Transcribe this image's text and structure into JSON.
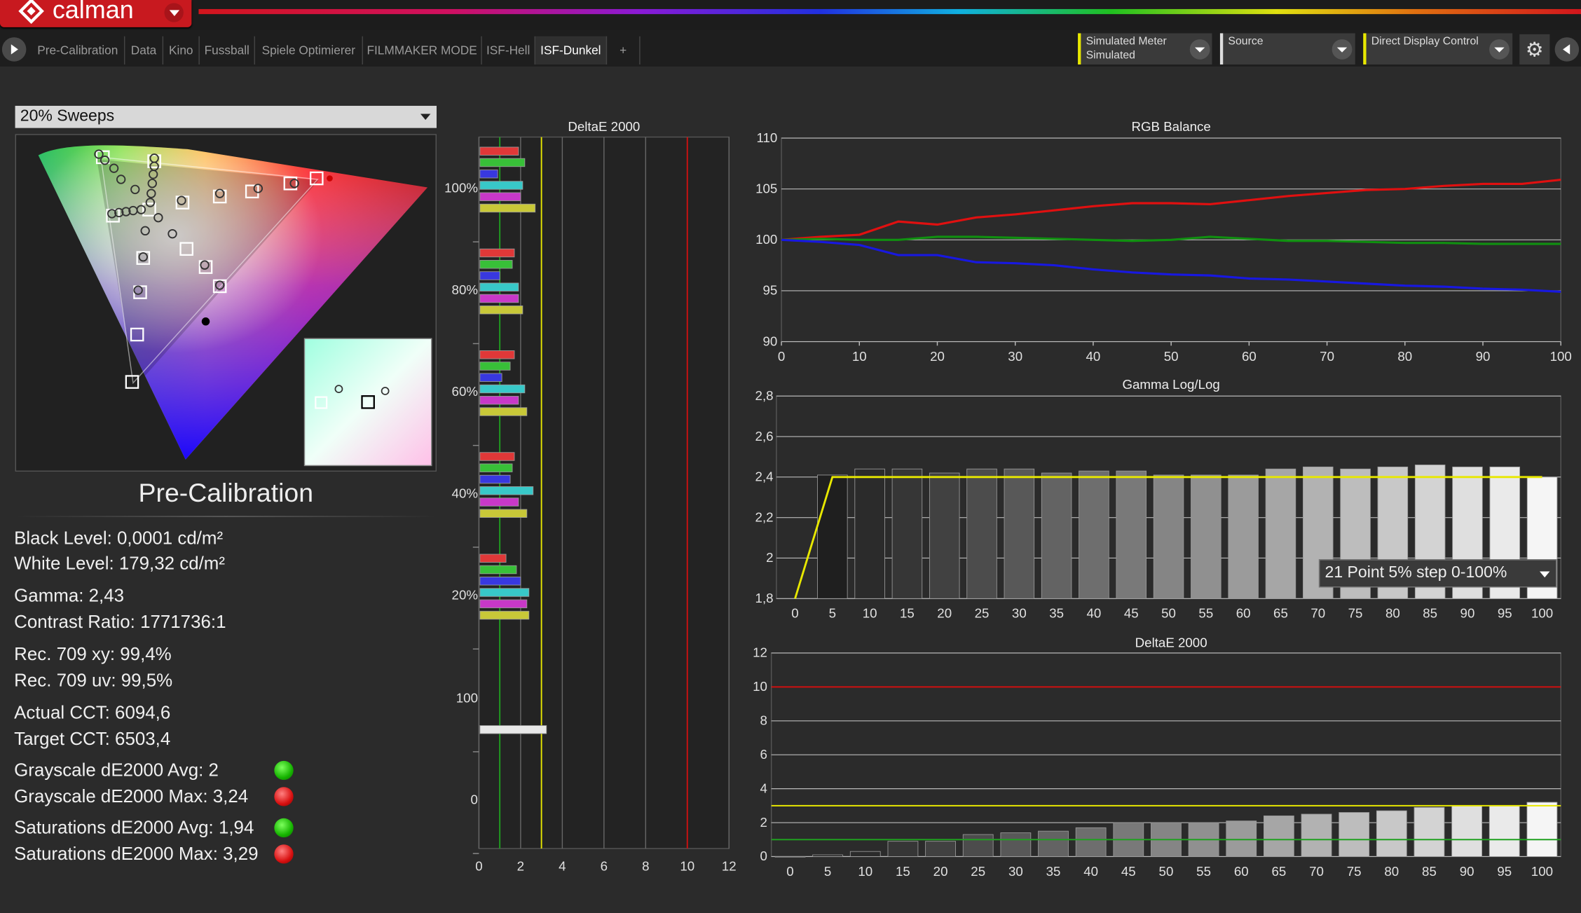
{
  "app": {
    "name": "calman"
  },
  "tabs": [
    "Pre-Calibration",
    "Data",
    "Kino",
    "Fussball",
    "Spiele Optimierer",
    "FILMMAKER MODE",
    "ISF-Hell",
    "ISF-Dunkel",
    "+"
  ],
  "active_tab": "ISF-Dunkel",
  "devices": {
    "meter": {
      "line1": "Simulated Meter",
      "line2": "Simulated"
    },
    "source": {
      "line1": "Source"
    },
    "display": {
      "line1": "Direct Display Control"
    }
  },
  "sweep_select": {
    "value": "20% Sweeps"
  },
  "gamma_select": {
    "value": "21 Point 5% step 0-100%"
  },
  "mode_title": "Pre-Calibration",
  "stats": {
    "black": "Black Level: 0,0001 cd/m²",
    "white": "White Level: 179,32 cd/m²",
    "gamma": "Gamma: 2,43",
    "contrast": "Contrast Ratio: 1771736:1",
    "xy": "Rec. 709 xy: 99,4%",
    "uv": "Rec. 709 uv: 99,5%",
    "actual_cct": "Actual CCT: 6094,6",
    "target_cct": "Target CCT: 6503,4",
    "gs_avg": "Grayscale dE2000 Avg: 2",
    "gs_max": "Grayscale dE2000 Max: 3,24",
    "sat_avg": "Saturations dE2000 Avg: 1,94",
    "sat_max": "Saturations dE2000 Max: 3,29"
  },
  "status_colors": {
    "pass": "#16b300",
    "fail": "#d81010"
  },
  "icons": [
    "play-icon",
    "add-tab-icon",
    "gear-icon",
    "collapse-left-icon",
    "dropdown-chevron-icon"
  ],
  "chart_data": [
    {
      "type": "bar",
      "title": "DeltaE 2000",
      "orientation": "horizontal",
      "xlim": [
        0,
        12
      ],
      "x_ticks": [
        "0",
        "2",
        "4",
        "6",
        "8",
        "10",
        "12"
      ],
      "group_labels": [
        "100%",
        "80%",
        "60%",
        "40%",
        "20%",
        "100",
        "0"
      ],
      "thresholds": [
        {
          "value": 1,
          "color": "#20a020"
        },
        {
          "value": 3,
          "color": "#e8e800"
        },
        {
          "value": 10,
          "color": "#d01010"
        }
      ],
      "groups": [
        {
          "label": "100%",
          "bars": [
            {
              "c": "red",
              "v": 1.9
            },
            {
              "c": "green",
              "v": 2.2
            },
            {
              "c": "blue",
              "v": 0.9
            },
            {
              "c": "cyan",
              "v": 2.1
            },
            {
              "c": "magenta",
              "v": 2.0
            },
            {
              "c": "yellow",
              "v": 2.7
            }
          ]
        },
        {
          "label": "80%",
          "bars": [
            {
              "c": "red",
              "v": 1.7
            },
            {
              "c": "green",
              "v": 1.6
            },
            {
              "c": "blue",
              "v": 1.0
            },
            {
              "c": "cyan",
              "v": 1.9
            },
            {
              "c": "magenta",
              "v": 1.9
            },
            {
              "c": "yellow",
              "v": 2.1
            }
          ]
        },
        {
          "label": "60%",
          "bars": [
            {
              "c": "red",
              "v": 1.7
            },
            {
              "c": "green",
              "v": 1.5
            },
            {
              "c": "blue",
              "v": 1.1
            },
            {
              "c": "cyan",
              "v": 2.2
            },
            {
              "c": "magenta",
              "v": 1.9
            },
            {
              "c": "yellow",
              "v": 2.3
            }
          ]
        },
        {
          "label": "40%",
          "bars": [
            {
              "c": "red",
              "v": 1.7
            },
            {
              "c": "green",
              "v": 1.6
            },
            {
              "c": "blue",
              "v": 1.5
            },
            {
              "c": "cyan",
              "v": 2.6
            },
            {
              "c": "magenta",
              "v": 1.9
            },
            {
              "c": "yellow",
              "v": 2.3
            }
          ]
        },
        {
          "label": "20%",
          "bars": [
            {
              "c": "red",
              "v": 1.3
            },
            {
              "c": "green",
              "v": 1.8
            },
            {
              "c": "blue",
              "v": 2.0
            },
            {
              "c": "cyan",
              "v": 2.4
            },
            {
              "c": "magenta",
              "v": 2.3
            },
            {
              "c": "yellow",
              "v": 2.4
            }
          ]
        },
        {
          "label": "100",
          "bars": [
            {
              "c": "white",
              "v": 3.24
            }
          ]
        }
      ]
    },
    {
      "type": "line",
      "title": "RGB Balance",
      "xlim": [
        0,
        100
      ],
      "ylim": [
        90,
        110
      ],
      "x_ticks": [
        "0",
        "10",
        "20",
        "30",
        "40",
        "50",
        "60",
        "70",
        "80",
        "90",
        "100"
      ],
      "y_ticks": [
        "90",
        "95",
        "100",
        "105",
        "110"
      ],
      "x": [
        0,
        5,
        10,
        15,
        20,
        25,
        30,
        35,
        40,
        45,
        50,
        55,
        60,
        65,
        70,
        75,
        80,
        85,
        90,
        95,
        100
      ],
      "series": [
        {
          "color": "#e01010",
          "values": [
            100,
            100.3,
            100.5,
            101.8,
            101.5,
            102.2,
            102.5,
            102.9,
            103.3,
            103.6,
            103.6,
            103.5,
            103.9,
            104.3,
            104.6,
            104.9,
            105.0,
            105.3,
            105.5,
            105.5,
            105.9
          ]
        },
        {
          "color": "#109010",
          "values": [
            100,
            100.1,
            100.0,
            100.0,
            100.3,
            100.3,
            100.2,
            100.1,
            100.0,
            99.9,
            100.0,
            100.3,
            100.1,
            99.9,
            99.9,
            99.8,
            99.7,
            99.7,
            99.6,
            99.6,
            99.6
          ]
        },
        {
          "color": "#1818e0",
          "values": [
            100,
            99.8,
            99.5,
            98.5,
            98.5,
            97.8,
            97.7,
            97.5,
            97.1,
            96.8,
            96.6,
            96.5,
            96.2,
            96.1,
            95.9,
            95.7,
            95.5,
            95.4,
            95.2,
            95.1,
            94.9
          ]
        }
      ]
    },
    {
      "type": "bar",
      "title": "Gamma Log/Log",
      "ylim": [
        1.8,
        2.8
      ],
      "y_ticks": [
        "1,8",
        "2",
        "2,2",
        "2,4",
        "2,6",
        "2,8"
      ],
      "categories": [
        "0",
        "5",
        "10",
        "15",
        "20",
        "25",
        "30",
        "35",
        "40",
        "45",
        "50",
        "55",
        "60",
        "65",
        "70",
        "75",
        "80",
        "85",
        "90",
        "95",
        "100"
      ],
      "values": [
        null,
        2.41,
        2.44,
        2.44,
        2.42,
        2.44,
        2.44,
        2.42,
        2.43,
        2.43,
        2.41,
        2.41,
        2.41,
        2.44,
        2.45,
        2.44,
        2.45,
        2.46,
        2.45,
        2.45,
        2.4
      ],
      "target": {
        "color": "#e8e800",
        "values": [
          1.8,
          2.4,
          2.4,
          2.4,
          2.4,
          2.4,
          2.4,
          2.4,
          2.4,
          2.4,
          2.4,
          2.4,
          2.4,
          2.4,
          2.4,
          2.4,
          2.4,
          2.4,
          2.4,
          2.4,
          2.4
        ]
      }
    },
    {
      "type": "bar",
      "title": "DeltaE 2000",
      "ylim": [
        0,
        12
      ],
      "y_ticks": [
        "0",
        "2",
        "4",
        "6",
        "8",
        "10",
        "12"
      ],
      "categories": [
        "0",
        "5",
        "10",
        "15",
        "20",
        "25",
        "30",
        "35",
        "40",
        "45",
        "50",
        "55",
        "60",
        "65",
        "70",
        "75",
        "80",
        "85",
        "90",
        "95",
        "100"
      ],
      "values": [
        0,
        0.1,
        0.3,
        0.9,
        0.9,
        1.3,
        1.4,
        1.5,
        1.7,
        2.0,
        2.0,
        2.0,
        2.1,
        2.4,
        2.5,
        2.6,
        2.7,
        2.9,
        3.0,
        3.0,
        3.2
      ],
      "thresholds": [
        {
          "value": 1,
          "color": "#20a020"
        },
        {
          "value": 3,
          "color": "#e8e800"
        },
        {
          "value": 10,
          "color": "#d01010"
        }
      ]
    }
  ]
}
